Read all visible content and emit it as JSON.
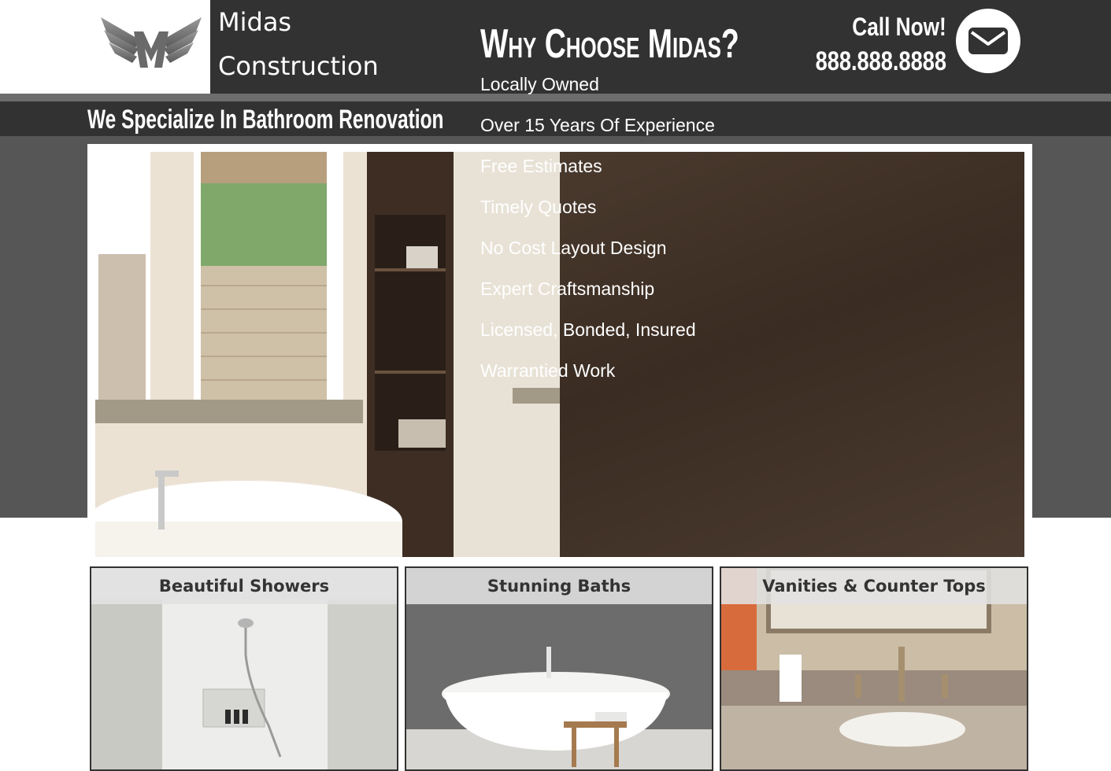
{
  "header": {
    "brand_line1": "Midas",
    "brand_line2": "Construction",
    "call_label": "Call Now!",
    "phone": "888.888.8888",
    "logo_icon": "wing-m-logo-icon",
    "mail_icon": "envelope-icon"
  },
  "tagline": "We Specialize In Bathroom Renovation",
  "hero": {
    "title": "Why Choose Midas?",
    "items": [
      "Locally Owned",
      "Over 15 Years Of Experience",
      "Free Estimates",
      "Timely Quotes",
      "No Cost Layout Design",
      "Expert Craftsmanship",
      "Licensed, Bonded, Insured",
      "Warrantied Work"
    ]
  },
  "cards": [
    {
      "title": "Beautiful Showers"
    },
    {
      "title": "Stunning Baths"
    },
    {
      "title": "Vanities & Counter Tops"
    }
  ],
  "colors": {
    "header_bg": "#323232",
    "band_bg": "#565656",
    "text_light": "#ffffff"
  }
}
